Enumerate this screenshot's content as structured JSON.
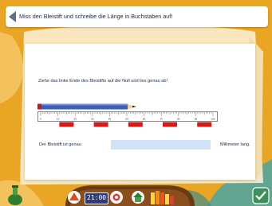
{
  "header": {
    "task": "Miss den Bleistift und schreibe die Länge in Buchstaben auf!"
  },
  "exercise": {
    "instruction": "Ziehe das linke Ende des Bleistifts auf die Null und lies genau ab!",
    "ruler": {
      "unit": "Millimeter",
      "min": 0,
      "max": 100,
      "tick_labels": [
        "0",
        "10",
        "20",
        "30",
        "40",
        "50",
        "60",
        "70",
        "80",
        "90",
        "100"
      ]
    },
    "answer": {
      "prefix": "Der Bleistift ist genau",
      "value": "",
      "suffix": "Millimeter lang."
    }
  },
  "toolbar": {
    "clock": "21:00"
  },
  "colors": {
    "background": "#e9a624",
    "input": "#cfe3f7",
    "pencil_body": "#3a5fb8",
    "ruler_marks": "#d31b1b"
  }
}
